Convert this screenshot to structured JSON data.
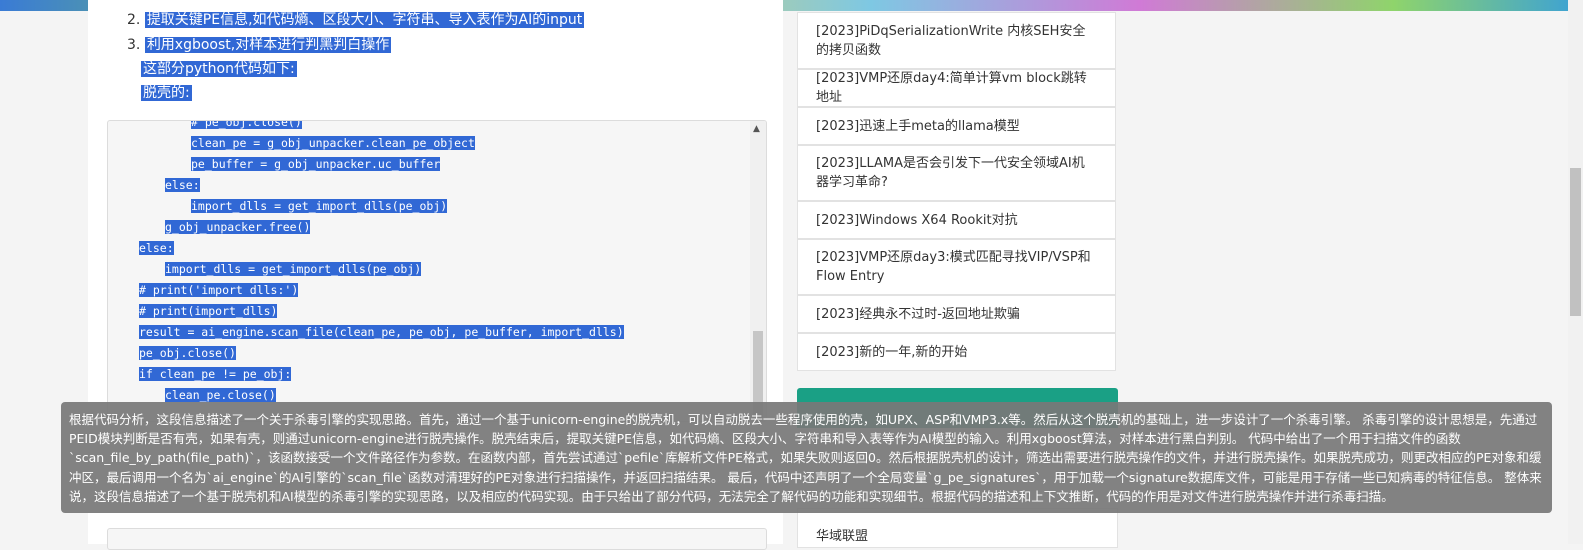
{
  "article": {
    "list": [
      {
        "num": "2.",
        "text": "提取关键PE信息,如代码熵、区段大小、字符串、导入表作为AI的input"
      },
      {
        "num": "3.",
        "text": "利用xgboost,对样本进行判黑判白操作"
      }
    ],
    "para1": "这部分python代码如下:",
    "para2": "脱壳的:"
  },
  "code": {
    "lines": [
      "# pe_obj.close()",
      "clean_pe = g_obj_unpacker.clean_pe_object",
      "pe_buffer = g_obj_unpacker.uc_buffer",
      "else:",
      "import_dlls = get_import_dlls(pe_obj)",
      "g_obj_unpacker.free()",
      "else:",
      "import_dlls = get_import_dlls(pe_obj)",
      "# print('import dlls:')",
      "# print(import_dlls)",
      "result = ai_engine.scan_file(clean_pe, pe_obj, pe_buffer, import_dlls)",
      "pe_obj.close()",
      "if clean_pe != pe_obj:",
      "clean_pe.close()"
    ]
  },
  "sidebar": {
    "items": [
      "[2023]PiDqSerializationWrite 内核SEH安全的拷贝函数",
      "[2023]VMP还原day4:简单计算vm block跳转地址",
      "[2023]迅速上手meta的llama模型",
      "[2023]LLAMA是否会引发下一代安全领域AI机器学习革命?",
      "[2023]Windows X64 Rookit对抗",
      "[2023]VMP还原day3:模式匹配寻找VIP/VSP和Flow Entry",
      "[2023]经典永不过时-返回地址欺骗",
      "[2023]新的一年,新的开始"
    ],
    "bottom_link": "华域联盟"
  },
  "tooltip": {
    "text": "根据代码分析，这段信息描述了一个关于杀毒引擎的实现思路。首先，通过一个基于unicorn-engine的脱壳机，可以自动脱去一些程序使用的壳，如UPX、ASP和VMP3.x等。然后从这个脱壳机的基础上，进一步设计了一个杀毒引擎。 杀毒引擎的设计思想是，先通过PEID模块判断是否有壳，如果有壳，则通过unicorn-engine进行脱壳操作。脱壳结束后，提取关键PE信息，如代码熵、区段大小、字符串和导入表等作为AI模型的输入。利用xgboost算法，对样本进行黑白判别。 代码中给出了一个用于扫描文件的函数`scan_file_by_path(file_path)`，该函数接受一个文件路径作为参数。在函数内部，首先尝试通过`pefile`库解析文件PE格式，如果失败则返回0。然后根据脱壳机的设计，筛选出需要进行脱壳操作的文件，并进行脱壳操作。如果脱壳成功，则更改相应的PE对象和缓冲区，最后调用一个名为`ai_engine`的AI引擎的`scan_file`函数对清理好的PE对象进行扫描操作，并返回扫描结果。 最后，代码中还声明了一个全局变量`g_pe_signatures`，用于加载一个signature数据库文件，可能是用于存储一些已知病毒的特征信息。 整体来说，这段信息描述了一个基于脱壳机和AI模型的杀毒引擎的实现思路，以及相应的代码实现。由于只给出了部分代码，无法完全了解代码的功能和实现细节。根据代码的描述和上下文推断，代码的作用是对文件进行脱壳操作并进行杀毒扫描。"
  }
}
